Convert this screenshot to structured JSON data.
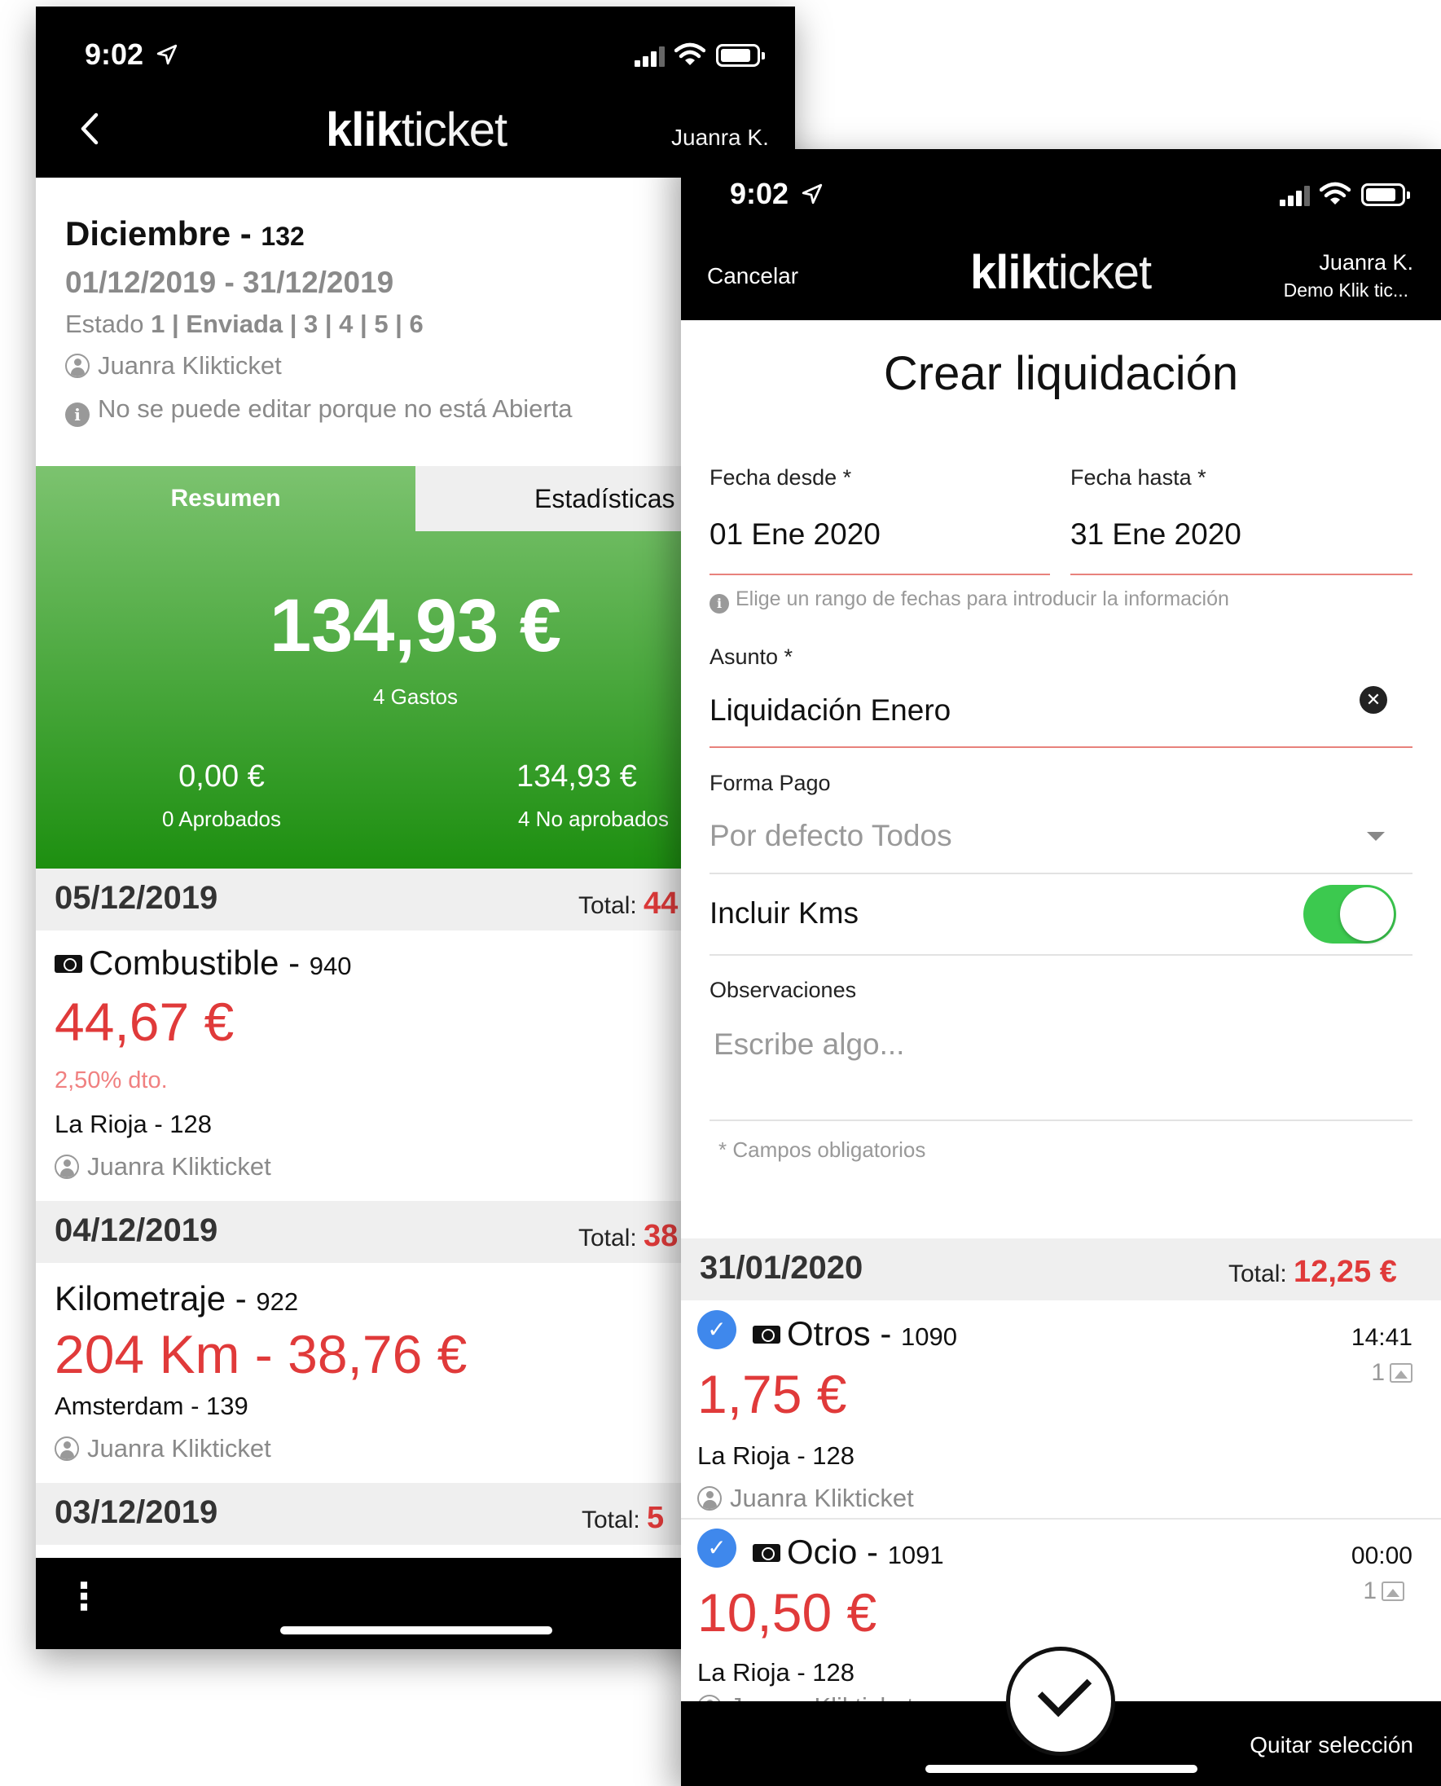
{
  "back_screen": {
    "status": {
      "time": "9:02"
    },
    "nav": {
      "brand_bold": "klik",
      "brand_light": "ticket",
      "user": "Juanra K."
    },
    "report": {
      "month": "Diciembre",
      "separator": " - ",
      "number": "132",
      "range": "01/12/2019 - 31/12/2019",
      "estado_label": "Estado ",
      "estado_steps": "1 | Enviada | 3 | 4 | 5 | 6",
      "owner": "Juanra Klikticket",
      "notice": "No se puede editar porque no está Abierta"
    },
    "tabs": {
      "resumen": "Resumen",
      "estadisticas": "Estadísticas"
    },
    "summary": {
      "total": "134,93 €",
      "gastos": "4 Gastos",
      "aprobados_amount": "0,00 €",
      "aprobados_label": "0 Aprobados",
      "no_aprobados_amount": "134,93 €",
      "no_aprobados_label": "4 No aprobados"
    },
    "sections": [
      {
        "date": "05/12/2019",
        "total_label": "Total: ",
        "total_value": "44"
      },
      {
        "date": "04/12/2019",
        "total_label": "Total: ",
        "total_value": "38"
      },
      {
        "date": "03/12/2019",
        "total_label": "Total: ",
        "total_value": "5"
      }
    ],
    "expenses": [
      {
        "title": "Combustible",
        "sep": " - ",
        "id": "940",
        "amount": "44,67 €",
        "discount": "2,50% dto.",
        "location": "La Rioja - 128",
        "person": "Juanra Klikticket"
      },
      {
        "title": "Kilometraje",
        "sep": " - ",
        "id": "922",
        "amount": "204 Km - 38,76 €",
        "location": "Amsterdam - 139",
        "person": "Juanra Klikticket"
      }
    ],
    "menu_icon": "⋮"
  },
  "front_screen": {
    "status": {
      "time": "9:02"
    },
    "nav": {
      "cancel": "Cancelar",
      "brand_bold": "klik",
      "brand_light": "ticket",
      "user": "Juanra K.",
      "company": "Demo Klik tic..."
    },
    "form": {
      "title": "Crear liquidación",
      "fecha_desde_label": "Fecha desde *",
      "fecha_desde_value": "01 Ene 2020",
      "fecha_hasta_label": "Fecha hasta *",
      "fecha_hasta_value": "31 Ene 2020",
      "date_hint": "Elige un rango de fechas para introducir la información",
      "asunto_label": "Asunto *",
      "asunto_value": "Liquidación Enero",
      "forma_pago_label": "Forma Pago",
      "forma_pago_value": "Por defecto Todos",
      "incluir_kms_label": "Incluir Kms",
      "incluir_kms_on": true,
      "observaciones_label": "Observaciones",
      "observaciones_placeholder": "Escribe algo...",
      "required_note": "* Campos obligatorios"
    },
    "section": {
      "date": "31/01/2020",
      "total_label": "Total: ",
      "total_value": "12,25 €"
    },
    "expenses": [
      {
        "title": "Otros",
        "sep": " - ",
        "id": "1090",
        "time": "14:41",
        "attachments": "1",
        "amount": "1,75 €",
        "location": "La Rioja - 128",
        "person": "Juanra Klikticket",
        "selected": true
      },
      {
        "title": "Ocio",
        "sep": " - ",
        "id": "1091",
        "time": "00:00",
        "attachments": "1",
        "amount": "10,50 €",
        "location": "La Rioja - 128",
        "person": "Juanra Klikticket",
        "selected": true
      }
    ],
    "footer": {
      "quitar": "Quitar selección"
    }
  },
  "colors": {
    "accent_red": "#e03a3a",
    "green_top": "#7cc36f",
    "green_bottom": "#1d8f10",
    "toggle_green": "#3cc94f",
    "check_blue": "#3f88ec"
  },
  "icons": [
    "location-arrow-icon",
    "signal-icon",
    "wifi-icon",
    "battery-icon",
    "back-chevron-icon",
    "person-icon",
    "info-icon",
    "cash-icon",
    "clear-icon",
    "dropdown-caret-icon",
    "checkmark-icon",
    "image-icon",
    "more-vertical-icon"
  ]
}
